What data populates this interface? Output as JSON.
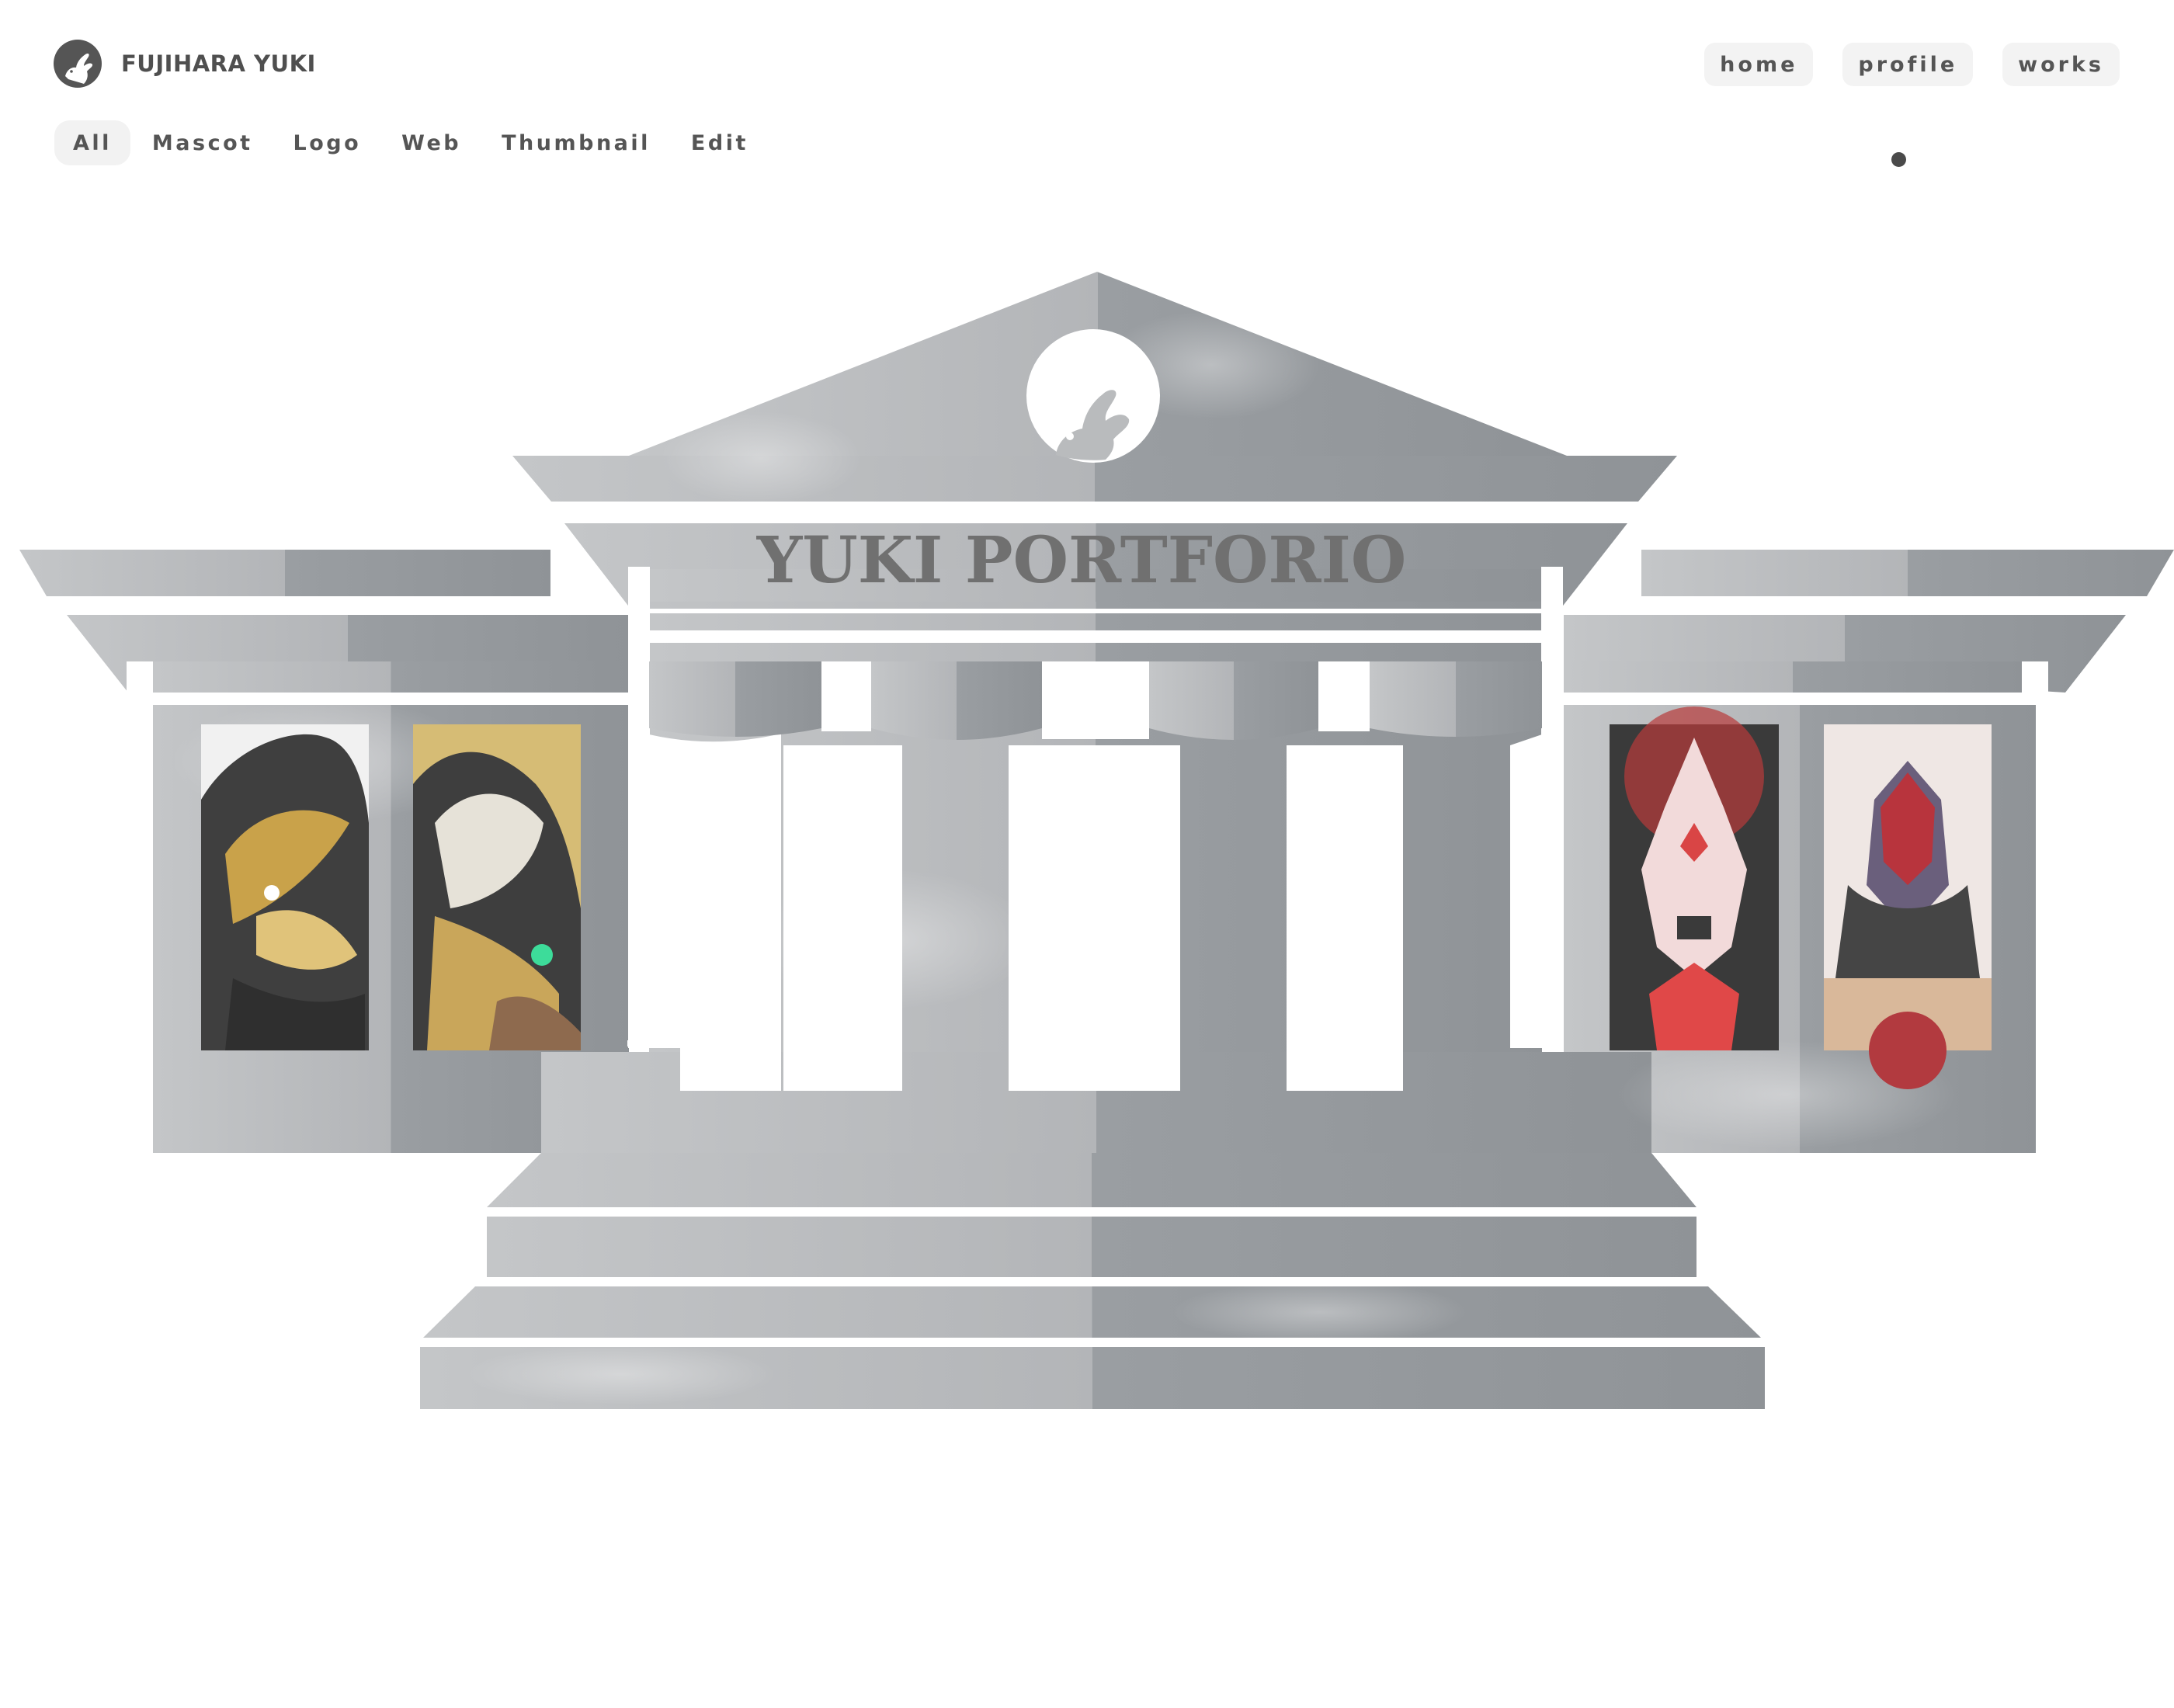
{
  "header": {
    "brand_name": "FUJIHARA YUKI",
    "logo_icon": "rabbit-logo-icon"
  },
  "top_nav": [
    {
      "label": "home"
    },
    {
      "label": "profile"
    },
    {
      "label": "works"
    }
  ],
  "filters": [
    {
      "label": "All",
      "active": true
    },
    {
      "label": "Mascot",
      "active": false
    },
    {
      "label": "Logo",
      "active": false
    },
    {
      "label": "Web",
      "active": false
    },
    {
      "label": "Thumbnail",
      "active": false
    },
    {
      "label": "Edit",
      "active": false
    }
  ],
  "hero": {
    "title": "YUKI PORTFORIO",
    "building_colors": {
      "stone_light": "#bcbec0",
      "stone_dark": "#979b9f",
      "title_color": "#707070"
    },
    "works": [
      {
        "name": "tiger-mascot-artwork"
      },
      {
        "name": "phoenix-mascot-artwork"
      },
      {
        "name": "lion-mascot-artwork"
      },
      {
        "name": "knight-mascot-artwork"
      }
    ]
  }
}
